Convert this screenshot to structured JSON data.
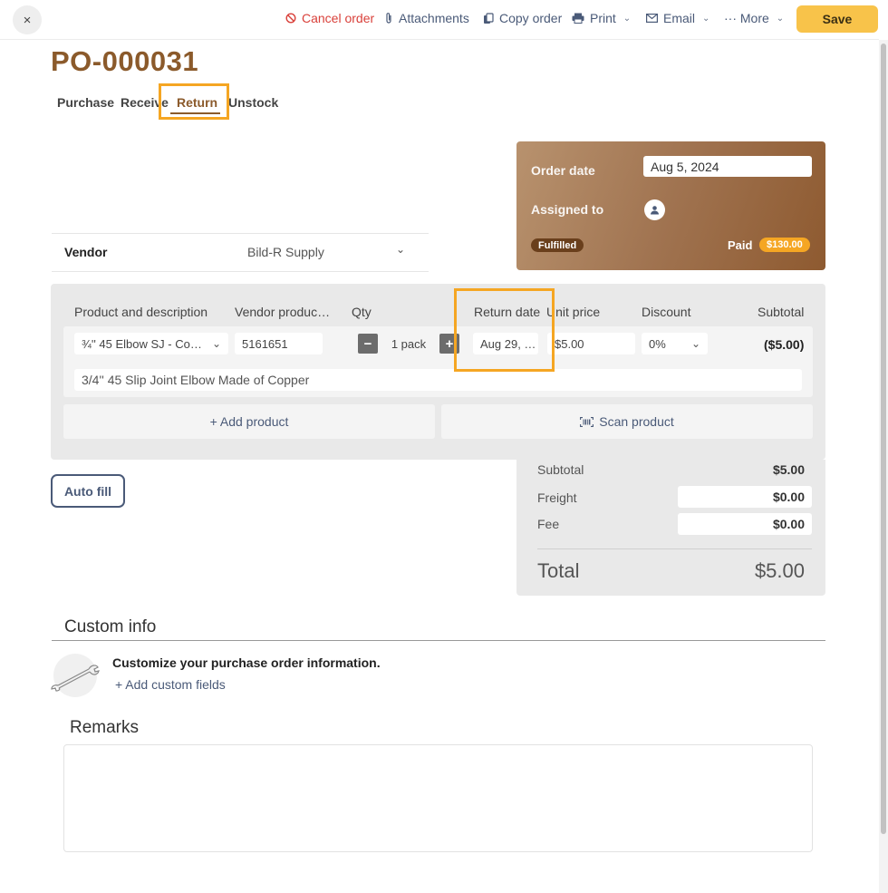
{
  "toolbar": {
    "close_icon": "×",
    "cancel_order": "Cancel order",
    "attachments": "Attachments",
    "copy_order": "Copy order",
    "print": "Print",
    "email": "Email",
    "more": "··· More",
    "save": "Save"
  },
  "order": {
    "title": "PO-000031",
    "tabs": [
      "Purchase",
      "Receive",
      "Return",
      "Unstock"
    ],
    "active_tab": "Return"
  },
  "summary": {
    "order_date_label": "Order date",
    "order_date_value": "Aug 5, 2024",
    "assigned_to_label": "Assigned to",
    "status_badge": "Fulfilled",
    "paid_label": "Paid",
    "paid_amount": "$130.00"
  },
  "vendor": {
    "label": "Vendor",
    "value": "Bild-R Supply"
  },
  "products": {
    "columns": {
      "product": "Product and description",
      "vendor_product": "Vendor produc…",
      "qty": "Qty",
      "return_date": "Return date",
      "unit_price": "Unit price",
      "discount": "Discount",
      "subtotal": "Subtotal"
    },
    "row": {
      "product": "¾'' 45 Elbow SJ - Co…",
      "vendor_code": "5161651",
      "qty_minus": "−",
      "qty": "1 pack",
      "qty_plus": "+",
      "return_date": "Aug 29, …",
      "unit_price": "$5.00",
      "discount": "0%",
      "subtotal": "($5.00)",
      "description": "3/4'' 45 Slip Joint Elbow Made of Copper"
    },
    "add_product": "+ Add product",
    "scan_product": "Scan product"
  },
  "totals": {
    "subtotal_label": "Subtotal",
    "subtotal_value": "$5.00",
    "freight_label": "Freight",
    "freight_value": "$0.00",
    "fee_label": "Fee",
    "fee_value": "$0.00",
    "total_label": "Total",
    "total_value": "$5.00"
  },
  "auto_fill": "Auto fill",
  "custom_info": {
    "title": "Custom info",
    "heading": "Customize your purchase order information.",
    "link": "+ Add custom fields"
  },
  "remarks": {
    "title": "Remarks"
  },
  "colors": {
    "brand_brown": "#8b5a2b",
    "save_yellow": "#f8c34a",
    "highlight_orange": "#f5a623",
    "link_slate": "#4a5a78",
    "cancel_red": "#d9403a"
  }
}
